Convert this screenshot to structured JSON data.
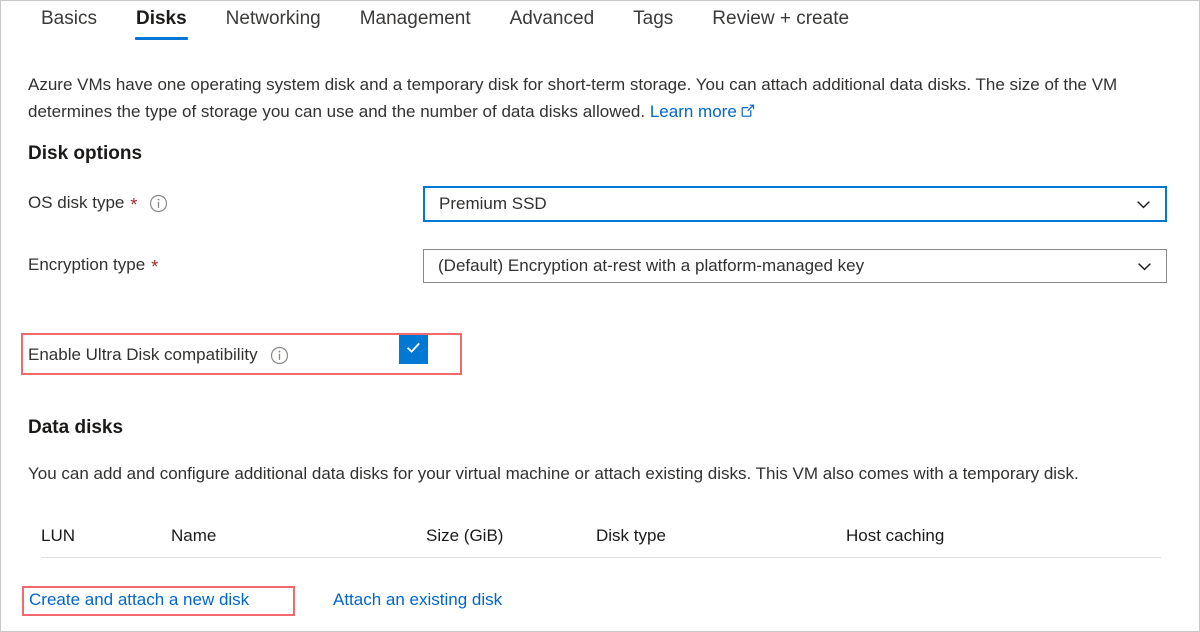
{
  "tabs": [
    {
      "label": "Basics",
      "active": false
    },
    {
      "label": "Disks",
      "active": true
    },
    {
      "label": "Networking",
      "active": false
    },
    {
      "label": "Management",
      "active": false
    },
    {
      "label": "Advanced",
      "active": false
    },
    {
      "label": "Tags",
      "active": false
    },
    {
      "label": "Review + create",
      "active": false
    }
  ],
  "intro": {
    "line1": "Azure VMs have one operating system disk and a temporary disk for short-term storage. You can attach additional data disks.",
    "line2": "The size of the VM determines the type of storage you can use and the number of data disks allowed.",
    "learn_more_label": "Learn more",
    "learn_more_icon": "external-link-icon"
  },
  "disk_options": {
    "title": "Disk options",
    "os_disk_type": {
      "label": "OS disk type",
      "required_marker": "*",
      "info_icon": "info-icon",
      "value": "Premium SSD",
      "chevron": "chevron-down-icon",
      "focused": true
    },
    "encryption_type": {
      "label": "Encryption type",
      "required_marker": "*",
      "value": "(Default) Encryption at-rest with a platform-managed key",
      "chevron": "chevron-down-icon"
    },
    "ultra_disk": {
      "label": "Enable Ultra Disk compatibility",
      "info_icon": "info-icon",
      "checked": true,
      "check_glyph": "checkmark-icon",
      "highlighted": true
    }
  },
  "data_disks": {
    "title": "Data disks",
    "description_line1": "You can add and configure additional data disks for your virtual machine or attach existing disks. This VM also comes with a",
    "description_line2": "temporary disk.",
    "columns": [
      "LUN",
      "Name",
      "Size (GiB)",
      "Disk type",
      "Host caching"
    ],
    "rows": [],
    "actions": {
      "create_attach": "Create and attach a new disk",
      "attach_existing": "Attach an existing disk",
      "create_attach_highlighted": true
    }
  },
  "colors": {
    "accent_blue": "#0078d4",
    "link_blue": "#0066cc",
    "annotation_red": "#f1696a",
    "required_red": "#a4262c",
    "text_primary": "#323130",
    "border_gray": "#8a8886"
  }
}
